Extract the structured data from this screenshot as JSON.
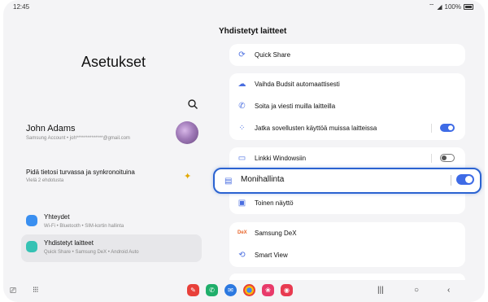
{
  "status_bar": {
    "time": "12:45",
    "battery": "100%"
  },
  "left_panel": {
    "title": "Asetukset",
    "profile": {
      "name": "John Adams",
      "subtitle": "Samsung Account  •  joh**************@gmail.com"
    },
    "sync_prompt": {
      "title": "Pidä tietosi turvassa ja synkronoituina",
      "subtitle": "Vielä 2 ehdotusta"
    },
    "nav_items": [
      {
        "title": "Yhteydet",
        "subtitle": "Wi-Fi  •  Bluetooth  •  SIM-kortin hallinta",
        "color": "#3a8ff0"
      },
      {
        "title": "Yhdistetyt laitteet",
        "subtitle": "Quick Share  •  Samsung DeX  •  Android Auto",
        "color": "#36c2b4"
      }
    ]
  },
  "right_panel": {
    "title": "Yhdistetyt laitteet",
    "rows": {
      "quick_share": "Quick Share",
      "budsit": "Vaihda Budsit automaattisesti",
      "soita": "Soita ja viesti muilla laitteilla",
      "jatka": "Jatka sovellusten käyttöä muissa laitteissa",
      "windows": "Linkki Windowsiin",
      "monihallinta": "Monihallinta",
      "toinen": "Toinen näyttö",
      "dex": "Samsung DeX",
      "smartview": "Smart View"
    },
    "toggles": {
      "jatka": true,
      "windows": false,
      "monihallinta": true
    }
  },
  "accent_color": "#3e6be6",
  "highlight_color": "#2b63d1"
}
